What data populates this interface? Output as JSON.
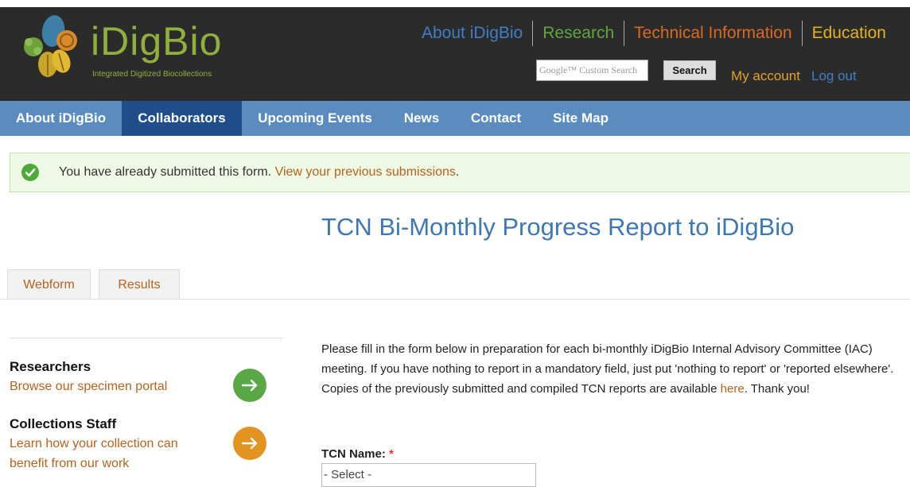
{
  "site": {
    "logo_text": "iDigBio",
    "tagline": "Integrated Digitized Biocollections"
  },
  "top_nav": [
    {
      "label": "About iDigBio",
      "color": "#3f7fc6"
    },
    {
      "label": "Research",
      "color": "#5ea63f"
    },
    {
      "label": "Technical Information",
      "color": "#d96a24"
    },
    {
      "label": "Education",
      "color": "#e3b21f"
    }
  ],
  "search": {
    "placeholder": "Google™ Custom Search",
    "button_label": "Search"
  },
  "account": {
    "my_account": "My account",
    "log_out": "Log out"
  },
  "main_nav": [
    {
      "label": "About iDigBio",
      "active": false
    },
    {
      "label": "Collaborators",
      "active": true
    },
    {
      "label": "Upcoming Events",
      "active": false
    },
    {
      "label": "News",
      "active": false
    },
    {
      "label": "Contact",
      "active": false
    },
    {
      "label": "Site Map",
      "active": false
    }
  ],
  "status": {
    "message": "You have already submitted this form.",
    "link": "View your previous submissions",
    "suffix": "."
  },
  "page_title": "TCN Bi-Monthly Progress Report to iDigBio",
  "tabs": [
    {
      "label": "Webform"
    },
    {
      "label": "Results"
    }
  ],
  "sidebar": {
    "items": [
      {
        "heading": "Researchers",
        "link": "Browse our specimen portal",
        "button_color": "#5aa845"
      },
      {
        "heading": "Collections Staff",
        "link": "Learn how your collection can benefit from our work",
        "button_color": "#e39420"
      }
    ]
  },
  "intro": {
    "text_before": "Please fill in the form below in preparation for each bi-monthly iDigBio Internal Advisory Committee (IAC) meeting. If you have nothing to report in a mandatory field, just put 'nothing to report' or 'reported elsewhere'. Copies of the previously submitted and compiled TCN reports are available ",
    "link": "here",
    "text_after": ". Thank you!"
  },
  "form": {
    "tcn_name_label": "TCN Name:",
    "required_mark": "*",
    "tcn_name_value": "- Select -"
  }
}
